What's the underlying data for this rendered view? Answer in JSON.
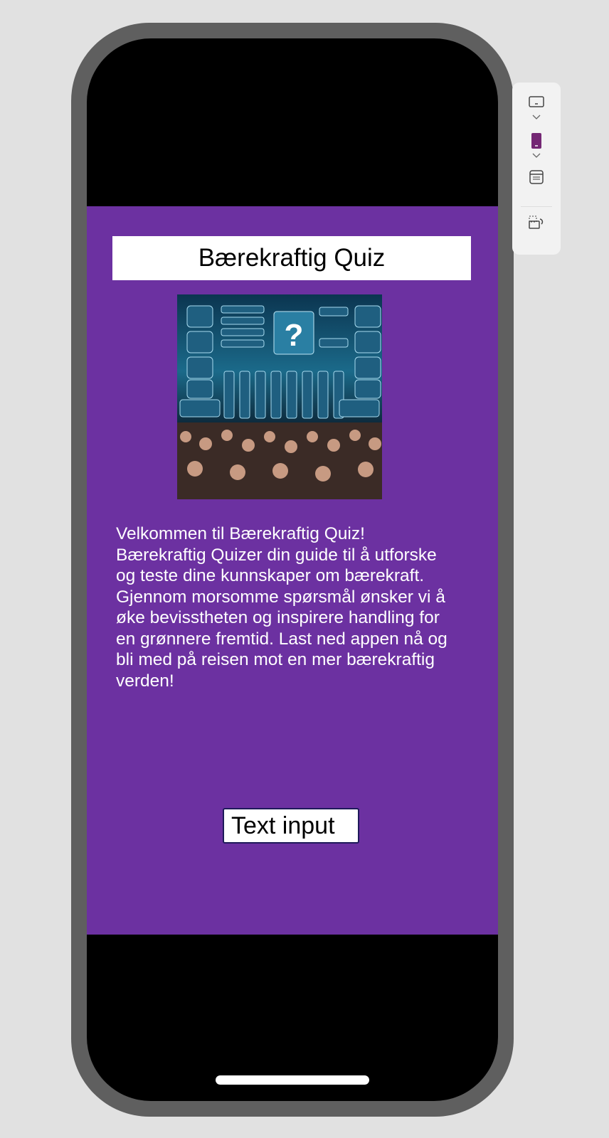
{
  "app": {
    "title": "Bærekraftig Quiz",
    "hero_image_alt": "Quiz show with audience",
    "description_lines": [
      "Velkommen til  Bærekraftig Quiz!",
      "Bærekraftig Quizer din guide til å utforske",
      "og teste dine kunnskaper om bærekraft.",
      "Gjennom morsomme spørsmål ønsker vi å",
      "øke bevisstheten og inspirere handling for",
      "en grønnere fremtid. Last ned appen nå og",
      "bli med på reisen mot en mer bærekraftig",
      "verden!"
    ],
    "text_input_label": "Text input",
    "colors": {
      "background": "#6c31a1",
      "frame": "#5f5f5f",
      "accent": "#742774"
    }
  },
  "toolbar": {
    "items": [
      {
        "icon": "tablet-icon"
      },
      {
        "icon": "chevron-down-icon"
      },
      {
        "icon": "phone-icon",
        "selected": true
      },
      {
        "icon": "chevron-down-icon"
      },
      {
        "icon": "web-layout-icon"
      },
      {
        "icon": "rotate-icon"
      }
    ]
  }
}
